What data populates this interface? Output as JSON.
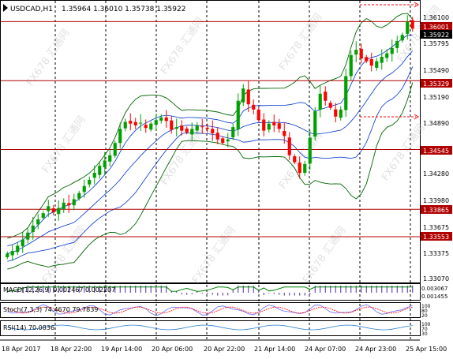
{
  "header": {
    "symbol": "USDCAD,H1",
    "ohlc": "1.35964 1.36010 1.35738 1.35922"
  },
  "colors": {
    "bullish": "#00a000",
    "bearish": "#ff0000",
    "bands": "#006400",
    "ma": "#0033cc",
    "levels": "#b00000",
    "grid": "#000000"
  },
  "price_axis": {
    "ticks": [
      "1.36100",
      "1.35795",
      "1.35490",
      "1.35190",
      "1.34890",
      "1.34280",
      "1.33980",
      "1.33675",
      "1.33375",
      "1.33070"
    ],
    "current_price": "1.35922",
    "levels": [
      "1.36001",
      "1.35329",
      "1.34545",
      "1.33865",
      "1.33553"
    ]
  },
  "indicators": {
    "macd": {
      "label": "MACD(12,26,9) 0.002467 0.002207",
      "axis": [
        "0.003067",
        "0.001455"
      ]
    },
    "stoch": {
      "label": "Stoch(7,3,3) 74.4670 79.7839",
      "axis": [
        "100",
        "80",
        "20",
        "0"
      ]
    },
    "rsi": {
      "label": "RSI(14) 70.0836",
      "axis": [
        "100",
        "70",
        "30",
        "0"
      ]
    }
  },
  "time_axis": {
    "labels": [
      "18 Apr 2017",
      "18 Apr 22:00",
      "19 Apr 14:00",
      "20 Apr 06:00",
      "20 Apr 22:00",
      "21 Apr 14:00",
      "24 Apr 07:00",
      "24 Apr 23:00",
      "25 Apr 15:00"
    ]
  },
  "watermark": "FX678 汇通网",
  "chart_data": {
    "type": "candlestick",
    "symbol": "USDCAD",
    "timeframe": "H1",
    "x": [
      "18 Apr 2017",
      "18 Apr 22:00",
      "19 Apr 14:00",
      "20 Apr 06:00",
      "20 Apr 22:00",
      "21 Apr 14:00",
      "24 Apr 07:00",
      "24 Apr 23:00",
      "25 Apr 15:00"
    ],
    "ylim": [
      1.3305,
      1.3622
    ],
    "close_path": [
      1.3336,
      1.3339,
      1.3345,
      1.3352,
      1.336,
      1.3368,
      1.3375,
      1.3382,
      1.339,
      1.3383,
      1.3388,
      1.3394,
      1.3391,
      1.3398,
      1.3405,
      1.3413,
      1.342,
      1.3428,
      1.3436,
      1.3442,
      1.3448,
      1.3462,
      1.3478,
      1.3486,
      1.3484,
      1.3482,
      1.3485,
      1.3479,
      1.3484,
      1.3488,
      1.3491,
      1.3487,
      1.3477,
      1.348,
      1.3476,
      1.3474,
      1.3478,
      1.3482,
      1.348,
      1.3478,
      1.3473,
      1.3466,
      1.3462,
      1.3466,
      1.348,
      1.351,
      1.3524,
      1.3506,
      1.35,
      1.3488,
      1.3476,
      1.3484,
      1.3482,
      1.3478,
      1.347,
      1.3448,
      1.344,
      1.3428,
      1.3438,
      1.3468,
      1.3498,
      1.3518,
      1.351,
      1.3502,
      1.3492,
      1.35,
      1.3538,
      1.3562,
      1.3568,
      1.3558,
      1.3555,
      1.355,
      1.3555,
      1.356,
      1.3564,
      1.357,
      1.3578,
      1.3585,
      1.36,
      1.3592
    ],
    "levels": [
      1.36001,
      1.35329,
      1.34545,
      1.33865,
      1.33553
    ],
    "current": 1.35922,
    "indicators": [
      {
        "name": "MACD(12,26,9)",
        "values": [
          0.002467,
          0.002207
        ]
      },
      {
        "name": "Stoch(7,3,3)",
        "values": [
          74.467,
          79.7839
        ]
      },
      {
        "name": "RSI(14)",
        "values": [
          70.0836
        ]
      }
    ]
  }
}
